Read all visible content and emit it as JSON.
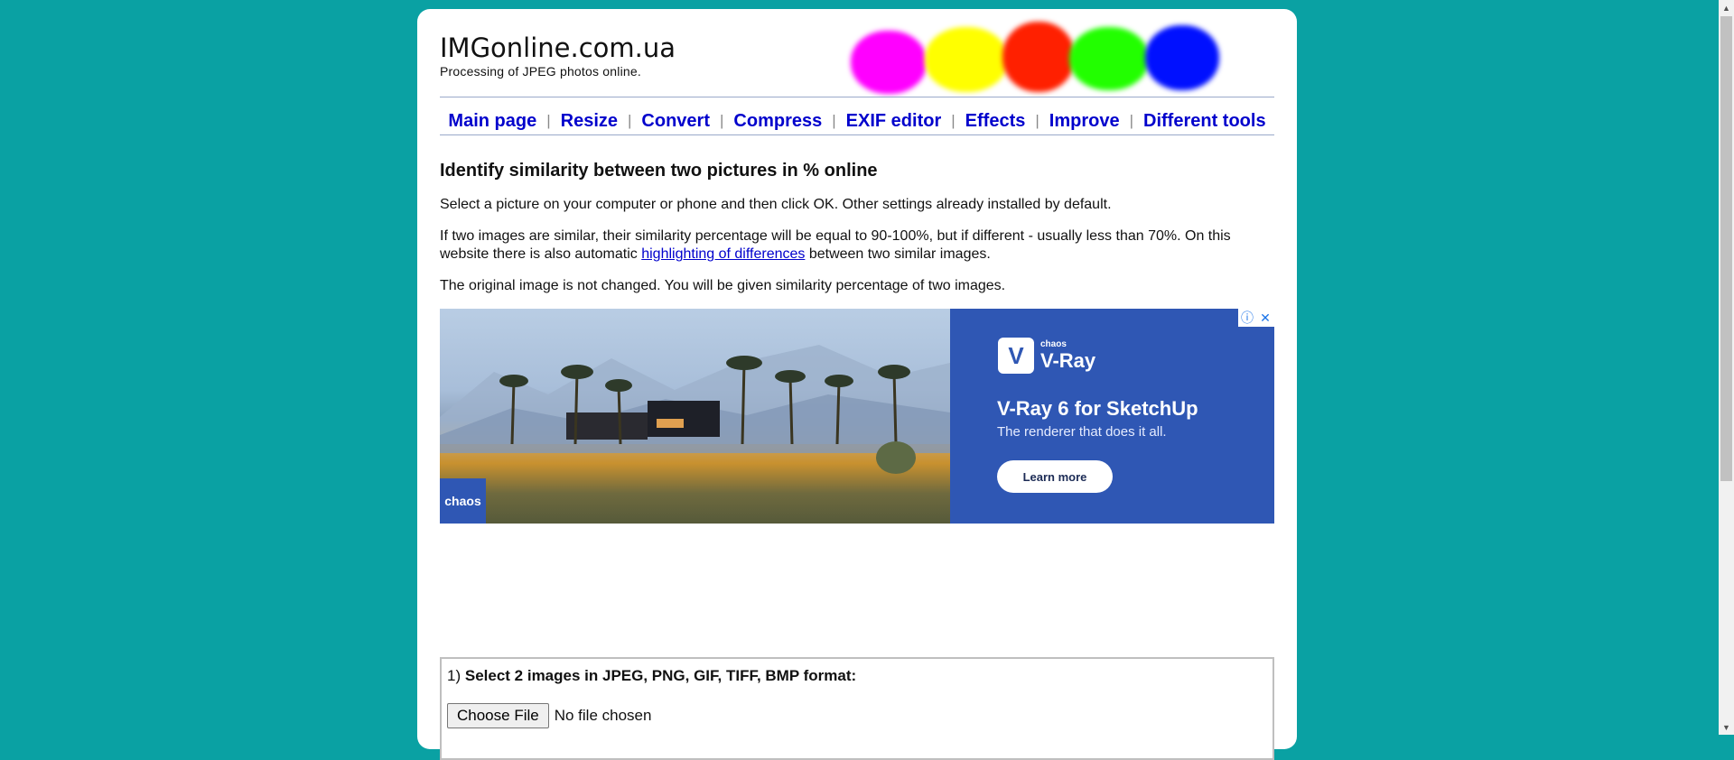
{
  "header": {
    "site_title": "IMGonline.com.ua",
    "site_subtitle": "Processing of JPEG photos online.",
    "blob_colors": [
      "#ff00ff",
      "#ffff00",
      "#ff2000",
      "#22ff00",
      "#0010ff"
    ]
  },
  "nav": {
    "items": [
      "Main page",
      "Resize",
      "Convert",
      "Compress",
      "EXIF editor",
      "Effects",
      "Improve",
      "Different tools"
    ],
    "separator": "|"
  },
  "main": {
    "heading": "Identify similarity between two pictures in % online",
    "para1": "Select a picture on your computer or phone and then click OK. Other settings already installed by default.",
    "para2_before": "If two images are similar, their similarity percentage will be equal to 90-100%, but if different - usually less than 70%. On this website there is also automatic ",
    "para2_link": "highlighting of differences",
    "para2_after": " between two similar images.",
    "para3": "The original image is not changed. You will be given similarity percentage of two images."
  },
  "ad": {
    "brand_tag": "chaos",
    "logo_small": "chaos",
    "logo_name": "V-Ray",
    "logo_glyph": "V",
    "headline": "V-Ray 6 for SketchUp",
    "tagline": "The renderer that does it all.",
    "cta": "Learn more",
    "info_icon": "ⓘ",
    "close_icon": "✕",
    "colors": {
      "panel": "#2f57b4"
    }
  },
  "form": {
    "step_number": "1)",
    "step_label": "Select 2 images in JPEG, PNG, GIF, TIFF, BMP format:",
    "file_button": "Choose File",
    "file_status": "No file chosen"
  },
  "colors": {
    "background": "#0aa1a3",
    "link": "#0000cc"
  }
}
